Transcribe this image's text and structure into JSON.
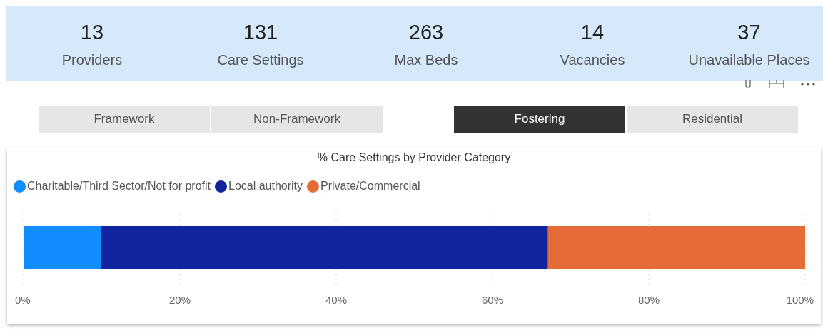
{
  "kpis": [
    {
      "value": "13",
      "label": "Providers"
    },
    {
      "value": "131",
      "label": "Care Settings"
    },
    {
      "value": "263",
      "label": "Max Beds"
    },
    {
      "value": "14",
      "label": "Vacancies"
    },
    {
      "value": "37",
      "label": "Unavailable Places"
    }
  ],
  "slicer_groups": [
    [
      {
        "label": "Framework",
        "selected": false
      },
      {
        "label": "Non-Framework",
        "selected": false
      }
    ],
    [
      {
        "label": "Fostering",
        "selected": true
      },
      {
        "label": "Residential",
        "selected": false
      }
    ]
  ],
  "chart": {
    "chart_data": {
      "type": "bar",
      "orientation": "horizontal",
      "stacked": true,
      "title": "% Care Settings by Provider Category",
      "categories": [
        null
      ],
      "grid": true,
      "series": [
        {
          "name": "Charitable/Third Sector/Not for profit",
          "color": "#118dff",
          "values": [
            9.9
          ]
        },
        {
          "name": "Local authority",
          "color": "#12239e",
          "values": [
            57.2
          ]
        },
        {
          "name": "Private/Commercial",
          "color": "#e66c37",
          "values": [
            32.9
          ]
        }
      ],
      "xlim": [
        0,
        100
      ],
      "xticks": [
        {
          "value": 0,
          "label": "0%"
        },
        {
          "value": 20,
          "label": "20%"
        },
        {
          "value": 40,
          "label": "40%"
        },
        {
          "value": 60,
          "label": "60%"
        },
        {
          "value": 80,
          "label": "80%"
        },
        {
          "value": 100,
          "label": "100%"
        }
      ]
    }
  }
}
